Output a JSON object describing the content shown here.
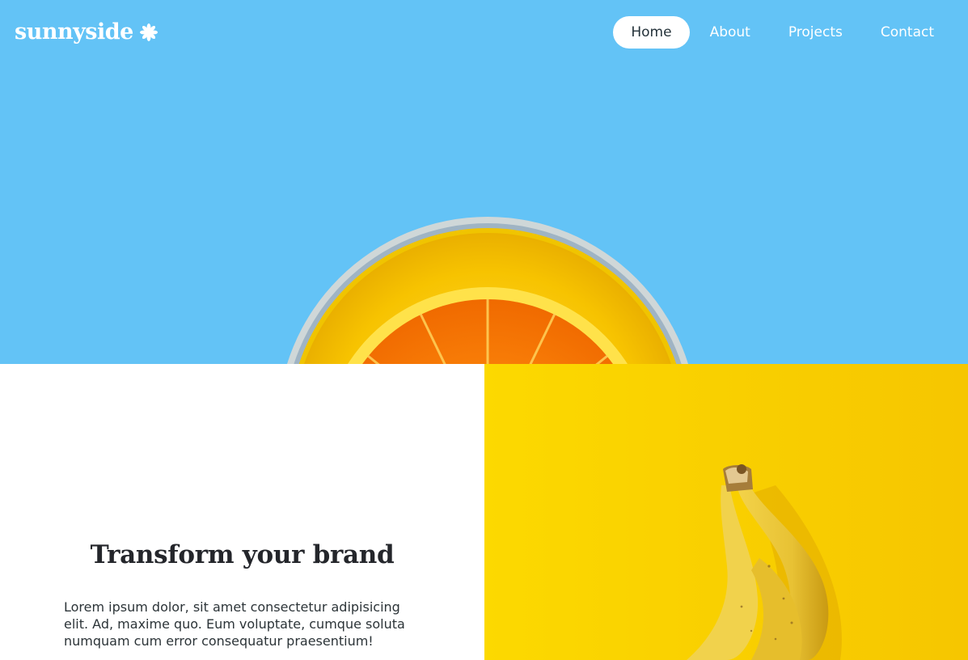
{
  "brand": {
    "logo_text": "sunnyside",
    "logo_icon": "asterisk-sun-icon"
  },
  "nav": {
    "items": [
      {
        "label": "Home",
        "active": true
      },
      {
        "label": "About",
        "active": false
      },
      {
        "label": "Projects",
        "active": false
      },
      {
        "label": "Contact",
        "active": false
      }
    ]
  },
  "hero": {
    "background_color": "#63c3f6",
    "image": "orange-slice-in-glass"
  },
  "feature": {
    "headline": "Transform your brand",
    "body": "Lorem ipsum dolor, sit amet consectetur adipisicing elit. Ad, maxime quo. Eum voluptate, cumque soluta numquam cum error consequatur praesentium!"
  },
  "feature_image": {
    "background_color": "#fbd400",
    "image": "bananas"
  }
}
